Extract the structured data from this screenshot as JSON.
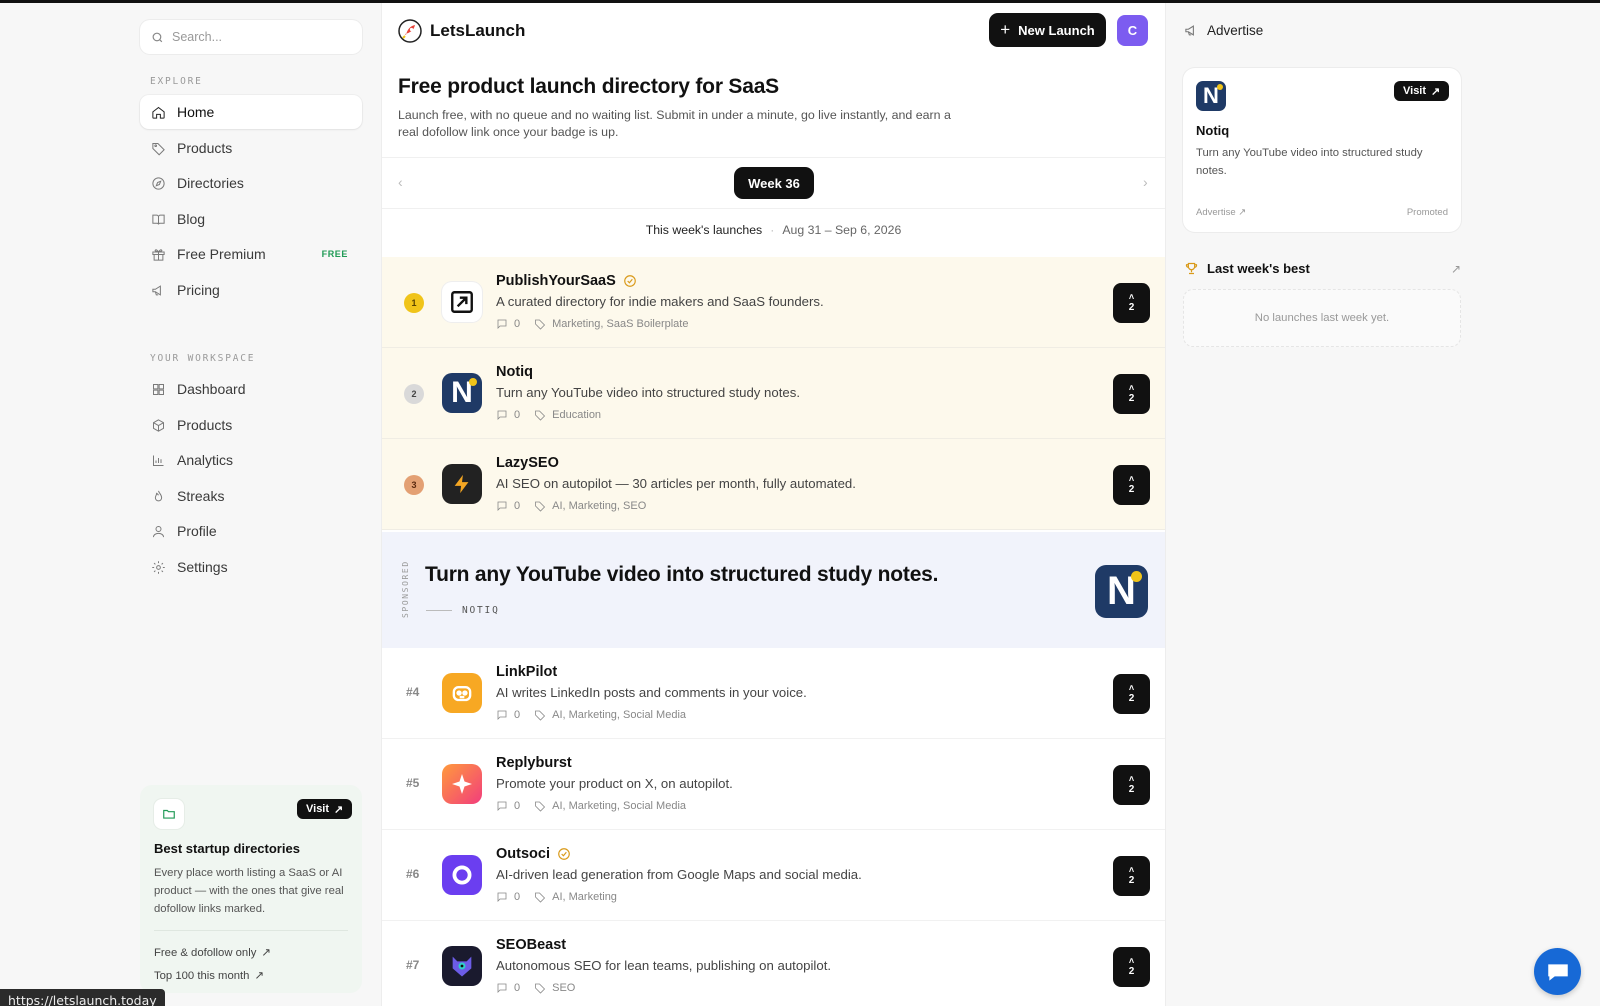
{
  "search": {
    "placeholder": "Search..."
  },
  "sidebar": {
    "explore_label": "EXPLORE",
    "explore": [
      {
        "label": "Home",
        "icon": "home-icon",
        "active": true
      },
      {
        "label": "Products",
        "icon": "tag-icon"
      },
      {
        "label": "Directories",
        "icon": "compass-icon"
      },
      {
        "label": "Blog",
        "icon": "book-icon"
      },
      {
        "label": "Free Premium",
        "icon": "gift-icon",
        "badge": "FREE"
      },
      {
        "label": "Pricing",
        "icon": "megaphone-icon"
      }
    ],
    "workspace_label": "YOUR WORKSPACE",
    "workspace": [
      {
        "label": "Dashboard",
        "icon": "grid-icon"
      },
      {
        "label": "Products",
        "icon": "box-icon"
      },
      {
        "label": "Analytics",
        "icon": "bar-chart-icon"
      },
      {
        "label": "Streaks",
        "icon": "flame-icon"
      },
      {
        "label": "Profile",
        "icon": "user-icon"
      },
      {
        "label": "Settings",
        "icon": "gear-icon"
      }
    ],
    "card": {
      "visit": "Visit",
      "title": "Best startup directories",
      "desc": "Every place worth listing a SaaS or AI product — with the ones that give real dofollow links marked.",
      "link1": "Free & dofollow only",
      "link2": "Top 100 this month"
    }
  },
  "status_url": "https://letslaunch.today",
  "header": {
    "brand": "LetsLaunch",
    "new_launch": "New Launch",
    "avatar": "C"
  },
  "hero": {
    "title": "Free product launch directory for SaaS",
    "subtitle": "Launch free, with no queue and no waiting list. Submit in under a minute, go live instantly, and earn a real dofollow link once your badge is up."
  },
  "week": {
    "label": "Week 36",
    "launches_label": "This week's launches",
    "dates": "Aug 31 – Sep 6, 2026"
  },
  "launches": [
    {
      "rank": "1",
      "name": "PublishYourSaaS",
      "verified": true,
      "desc": "A curated directory for indie makers and SaaS founders.",
      "comments": "0",
      "tags": "Marketing, SaaS Boilerplate",
      "votes": "2",
      "icon": "arrow-box-icon"
    },
    {
      "rank": "2",
      "name": "Notiq",
      "verified": false,
      "desc": "Turn any YouTube video into structured study notes.",
      "comments": "0",
      "tags": "Education",
      "votes": "2",
      "icon": "notiq-logo-icon"
    },
    {
      "rank": "3",
      "name": "LazySEO",
      "verified": false,
      "desc": "AI SEO on autopilot — 30 articles per month, fully automated.",
      "comments": "0",
      "tags": "AI, Marketing, SEO",
      "votes": "2",
      "icon": "lightning-icon"
    },
    {
      "rank": "#4",
      "name": "LinkPilot",
      "verified": false,
      "desc": "AI writes LinkedIn posts and comments in your voice.",
      "comments": "0",
      "tags": "AI, Marketing, Social Media",
      "votes": "2",
      "icon": "robot-icon"
    },
    {
      "rank": "#5",
      "name": "Replyburst",
      "verified": false,
      "desc": "Promote your product on X, on autopilot.",
      "comments": "0",
      "tags": "AI, Marketing, Social Media",
      "votes": "2",
      "icon": "sparkle-icon"
    },
    {
      "rank": "#6",
      "name": "Outsoci",
      "verified": true,
      "desc": "AI-driven lead generation from Google Maps and social media.",
      "comments": "0",
      "tags": "AI, Marketing",
      "votes": "2",
      "icon": "ring-icon"
    },
    {
      "rank": "#7",
      "name": "SEOBeast",
      "verified": false,
      "desc": "Autonomous SEO for lean teams, publishing on autopilot.",
      "comments": "0",
      "tags": "SEO",
      "votes": "2",
      "icon": "beast-icon"
    }
  ],
  "sponsored": {
    "label": "SPONSORED",
    "headline": "Turn any YouTube video into structured study notes.",
    "brand": "NOTIQ"
  },
  "advertise": {
    "heading": "Advertise",
    "visit": "Visit",
    "name": "Notiq",
    "desc": "Turn any YouTube video into structured study notes.",
    "advertise_link": "Advertise",
    "promoted": "Promoted"
  },
  "last_week": {
    "heading": "Last week's best",
    "empty": "No launches last week yet."
  },
  "colors": {
    "accent": "#111111",
    "avatar": "#7c5cf0",
    "top_row": "#fdf9ec",
    "sponsored": "#f1f3fb",
    "notiq": "#1f3a66",
    "gold": "#f0c419",
    "chat": "#1769d6"
  }
}
